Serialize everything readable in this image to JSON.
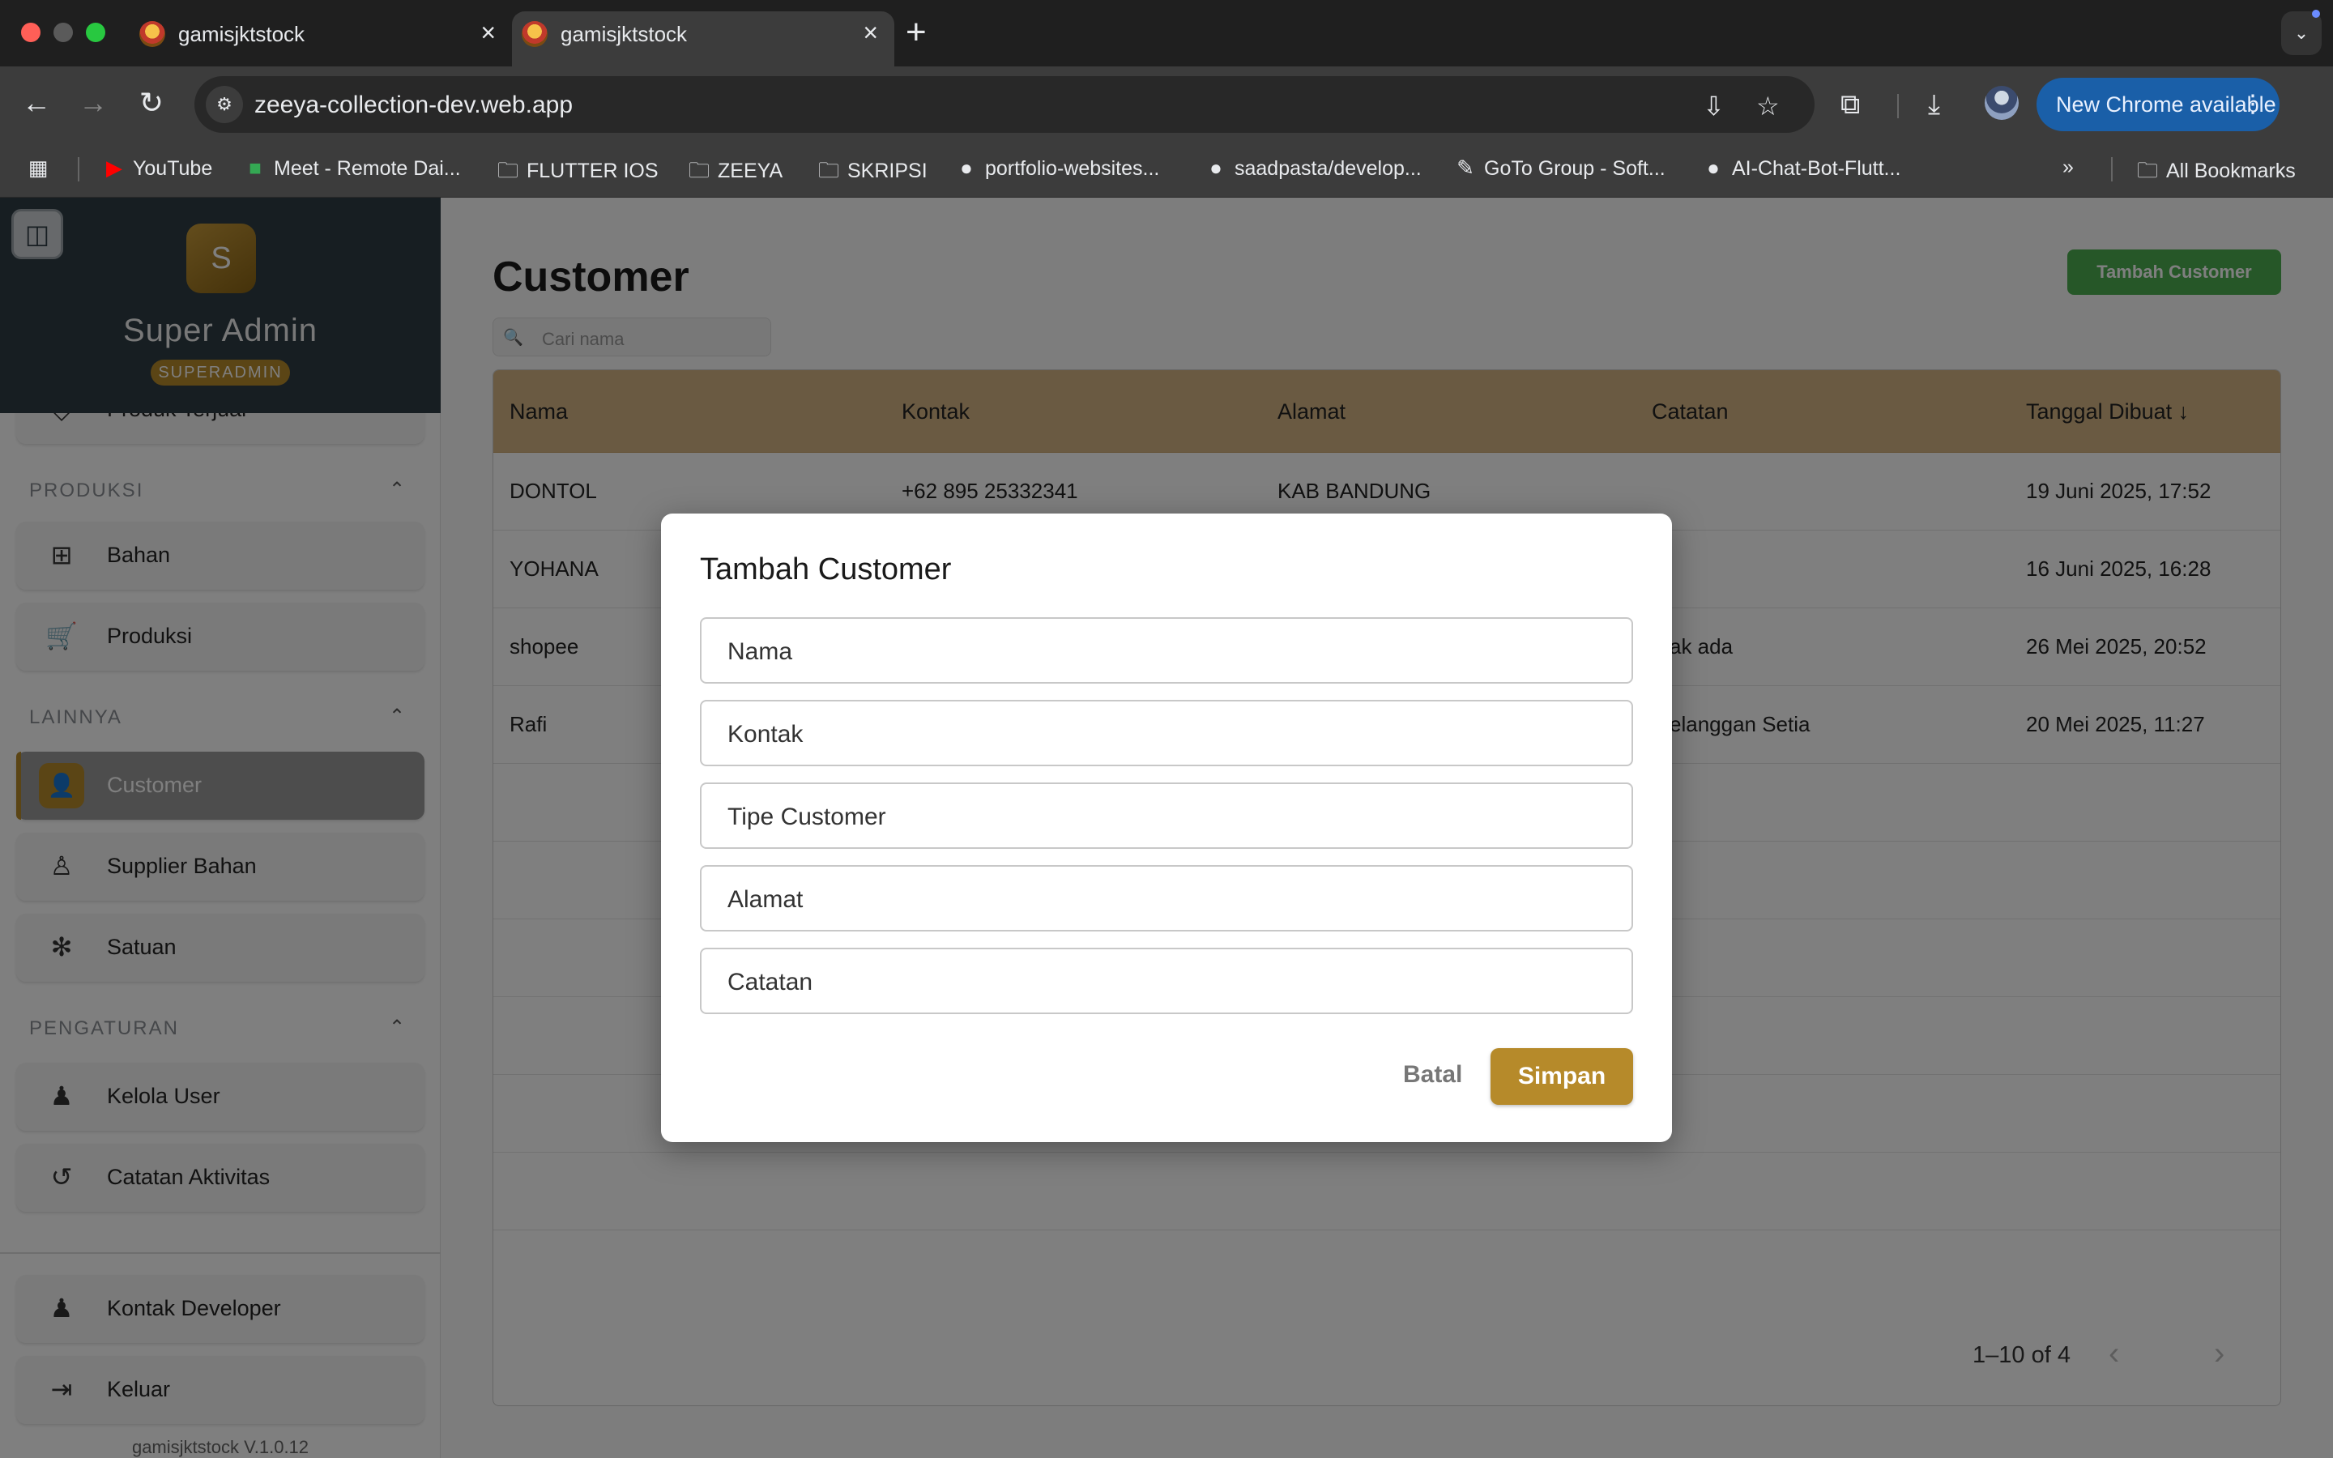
{
  "browser": {
    "tabs": [
      {
        "title": "gamisjktstock"
      },
      {
        "title": "gamisjktstock"
      }
    ],
    "url": "zeeya-collection-dev.web.app",
    "update_button": "New Chrome available",
    "bookmarks": [
      {
        "label": "YouTube",
        "icon": "youtube-icon"
      },
      {
        "label": "Meet - Remote Dai...",
        "icon": "meet-icon"
      },
      {
        "label": "FLUTTER IOS",
        "icon": "folder-icon"
      },
      {
        "label": "ZEEYA",
        "icon": "folder-icon"
      },
      {
        "label": "SKRIPSI",
        "icon": "folder-icon"
      },
      {
        "label": "portfolio-websites...",
        "icon": "github-icon"
      },
      {
        "label": "saadpasta/develop...",
        "icon": "github-icon"
      },
      {
        "label": "GoTo Group - Soft...",
        "icon": "pen-icon"
      },
      {
        "label": "AI-Chat-Bot-Flutt...",
        "icon": "github-icon"
      }
    ],
    "all_bookmarks": "All Bookmarks"
  },
  "sidebar": {
    "avatar_letter": "S",
    "user_name": "Super Admin",
    "role": "SUPERADMIN",
    "partial_item": "Produk Terjual",
    "sections": [
      {
        "title": "PRODUKSI",
        "items": [
          {
            "label": "Bahan",
            "icon": "grid-icon"
          },
          {
            "label": "Produksi",
            "icon": "cart-icon"
          }
        ]
      },
      {
        "title": "LAINNYA",
        "items": [
          {
            "label": "Customer",
            "icon": "person-add-icon"
          },
          {
            "label": "Supplier Bahan",
            "icon": "person-icon"
          },
          {
            "label": "Satuan",
            "icon": "snowflake-icon"
          }
        ]
      },
      {
        "title": "PENGATURAN",
        "items": [
          {
            "label": "Kelola User",
            "icon": "person-icon"
          },
          {
            "label": "Catatan Aktivitas",
            "icon": "history-icon"
          }
        ]
      }
    ],
    "footer_items": [
      {
        "label": "Kontak Developer",
        "icon": "person-icon"
      },
      {
        "label": "Keluar",
        "icon": "logout-icon"
      }
    ],
    "version": "gamisjktstock V.1.0.12"
  },
  "main": {
    "title": "Customer",
    "add_button": "Tambah Customer",
    "search_placeholder": "Cari nama",
    "table": {
      "columns": [
        "Nama",
        "Kontak",
        "Alamat",
        "Catatan",
        "Tanggal Dibuat"
      ],
      "rows": [
        [
          "DONTOL",
          "+62 895 25332341",
          "KAB BANDUNG",
          "",
          "19 Juni 2025, 17:52"
        ],
        [
          "YOHANA",
          "",
          "",
          "",
          "16 Juni 2025, 16:28"
        ],
        [
          "shopee",
          "",
          "",
          "ak ada",
          "26 Mei 2025, 20:52"
        ],
        [
          "Rafi",
          "",
          "",
          "elanggan Setia",
          "20 Mei 2025, 11:27"
        ]
      ]
    },
    "pagination": "1–10 of 4"
  },
  "dialog": {
    "title": "Tambah Customer",
    "fields": [
      "Nama",
      "Kontak",
      "Tipe Customer",
      "Alamat",
      "Catatan"
    ],
    "cancel": "Batal",
    "save": "Simpan"
  },
  "colors": {
    "accent_gold": "#b68a2a",
    "table_header": "#d4b585",
    "sidebar_header": "#2f3d45",
    "add_button_green": "#4caf50"
  }
}
